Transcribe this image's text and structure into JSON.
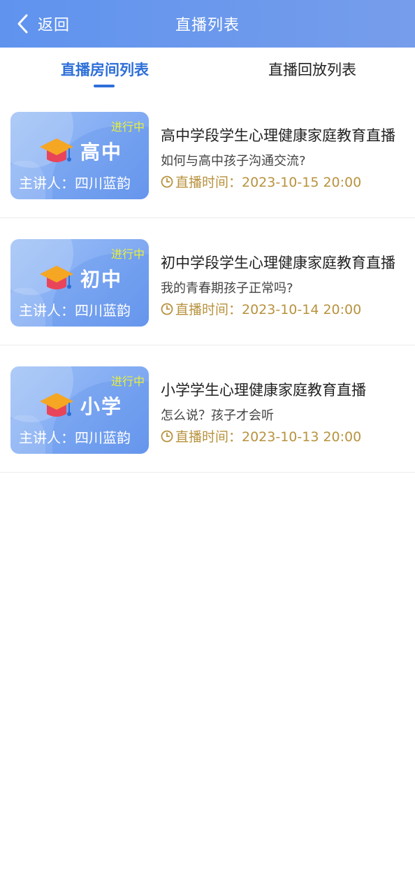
{
  "header": {
    "back_label": "返回",
    "title": "直播列表"
  },
  "tabs": [
    {
      "label": "直播房间列表",
      "active": true
    },
    {
      "label": "直播回放列表",
      "active": false
    }
  ],
  "colors": {
    "header_start": "#5f93ee",
    "header_end": "#769deb",
    "accent": "#2e6fd9",
    "status": "#e8f03a",
    "time": "#b8923e"
  },
  "items": [
    {
      "status": "进行中",
      "grade": "高中",
      "speaker": "主讲人：四川蓝韵",
      "title": "高中学段学生心理健康家庭教育直播",
      "subtitle": "如何与高中孩子沟通交流?",
      "time": "直播时间：2023-10-15 20:00",
      "icon": "graduation-cap-icon"
    },
    {
      "status": "进行中",
      "grade": "初中",
      "speaker": "主讲人：四川蓝韵",
      "title": "初中学段学生心理健康家庭教育直播",
      "subtitle": "我的青春期孩子正常吗?",
      "time": "直播时间：2023-10-14 20:00",
      "icon": "graduation-cap-icon"
    },
    {
      "status": "进行中",
      "grade": "小学",
      "speaker": "主讲人：四川蓝韵",
      "title": "小学学生心理健康家庭教育直播",
      "subtitle": "怎么说？孩子才会听",
      "time": "直播时间：2023-10-13 20:00",
      "icon": "graduation-cap-icon"
    }
  ]
}
